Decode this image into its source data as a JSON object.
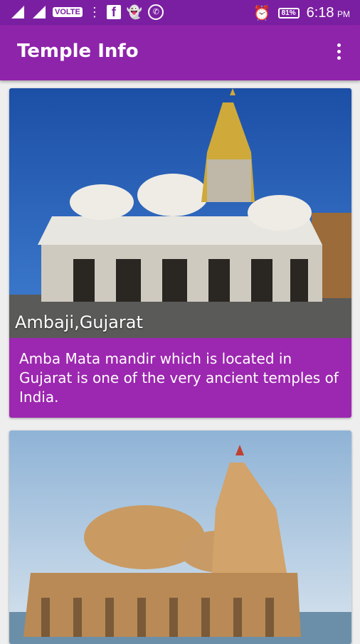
{
  "status_bar": {
    "network_badge": "VOLTE",
    "battery_level": "81%",
    "time": "6:18",
    "ampm": "PM",
    "icons": [
      "signal-icon",
      "signal-icon",
      "more-vert-icon",
      "facebook-icon",
      "snapchat-icon",
      "whatsapp-icon",
      "alarm-icon",
      "battery-icon"
    ]
  },
  "app_bar": {
    "title": "Temple Info"
  },
  "cards": [
    {
      "caption": "Ambaji,Gujarat",
      "description": "Amba Mata mandir which is located in Gujarat is one of the very ancient temples of India."
    },
    {
      "caption": "",
      "description": ""
    }
  ],
  "colors": {
    "primary": "#8e24aa",
    "primary_dark": "#7b1fa2",
    "card_accent": "#9c27b0"
  }
}
